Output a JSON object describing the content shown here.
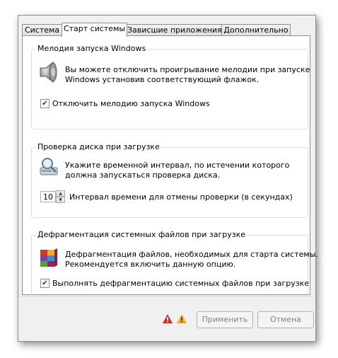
{
  "tabs": [
    {
      "label": "Система",
      "active": false
    },
    {
      "label": "Старт системы",
      "active": true
    },
    {
      "label": "Зависшие приложения",
      "active": false
    },
    {
      "label": "Дополнительно",
      "active": false
    }
  ],
  "groups": {
    "startup_sound": {
      "title": "Мелодия запуска Windows",
      "desc_line1": "Вы можете отключить проигрывание мелодии при запуске",
      "desc_line2": "Windows установив соответствующий флажок.",
      "checkbox_label": "Отключить мелодию запуска Windows",
      "checked": true,
      "icon": "speaker-icon"
    },
    "disk_check": {
      "title": "Проверка диска при загрузке",
      "desc_line1": "Укажите временной интервал, по истечении которого",
      "desc_line2": "должна запускаться проверка диска.",
      "spin_value": "10",
      "spin_label": "Интервал времени для отмены проверки (в секундах)",
      "icon": "disk-check-icon"
    },
    "defrag": {
      "title": "Дефрагментация системных файлов при загрузке",
      "desc_line1": "Дефрагментация файлов, необходимых для старта системы.",
      "desc_line2": "Рекомендуется включить данную опцию.",
      "checkbox_label": "Выполнять дефрагментацию системных файлов при загрузке",
      "checked": true,
      "icon": "defrag-icon"
    }
  },
  "buttons": {
    "apply": "Применить",
    "cancel": "Отмена"
  },
  "colors": {
    "error": "#c8302c",
    "warning": "#f0a92e",
    "group_border": "#d5dfe5"
  }
}
